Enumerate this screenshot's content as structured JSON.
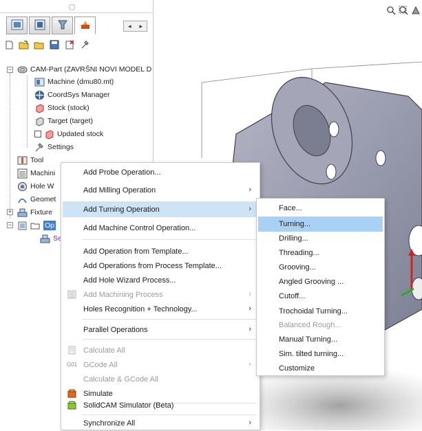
{
  "colors": {
    "menu_highlight": "#cde3f6",
    "submenu_highlight": "#a9d1f5",
    "disabled_text": "#9b9b9b",
    "part_color": "#9ea0b2"
  },
  "icons": {
    "viewport_tools": [
      "zoom-icon",
      "zoom-fit-icon",
      "pan-icon"
    ]
  },
  "panel": {
    "tabs": [
      "solidworks-feature-tab",
      "property-manager-tab",
      "configuration-tab",
      "solidcam-tab"
    ],
    "tab_nav": {
      "left": "◂",
      "right": "▸"
    },
    "toolbar": [
      "new-icon",
      "open-icon",
      "open-folder-icon",
      "save-icon",
      "delete-icon",
      "settings-icon"
    ],
    "tree": {
      "part": "CAM-Part (ZAVRŠNI NOVI MODEL D",
      "machine": "Machine (dmu80.mt)",
      "coordsys": "CoordSys Manager",
      "stock": "Stock (stock)",
      "target": "Target (target)",
      "updated_stock": "Updated stock",
      "settings": "Settings",
      "tool": "Tool",
      "machining": "Machini",
      "hole": "Hole W",
      "geometries": "Geomet",
      "fixtures": "Fixture",
      "operations": "Op",
      "setup": "Se"
    }
  },
  "context_menu": {
    "add_probe": "Add Probe Operation...",
    "add_milling": "Add Milling Operation",
    "add_turning": "Add Turning Operation",
    "add_machine_control": "Add Machine Control Operation...",
    "add_from_template": "Add Operation from Template...",
    "add_from_process_template": "Add Operations from Process Template...",
    "add_hole_wizard": "Add Hole Wizard Process...",
    "add_machining_process": "Add Machining Process",
    "holes_recognition": "Holes Recognition + Technology...",
    "parallel_operations": "Parallel Operations",
    "calculate_all": "Calculate All",
    "gcode_all": "GCode All",
    "calculate_gcode_all": "Calculate & GCode All",
    "simulate": "Simulate",
    "simulator_beta": "SolidCAM Simulator (Beta)",
    "synchronize_all": "Synchronize All",
    "gcode_icon_text": "G01",
    "submenu_arrow": "›"
  },
  "turning_submenu": {
    "face": "Face...",
    "turning": "Turning...",
    "drilling": "Drilling...",
    "threading": "Threading...",
    "grooving": "Grooving...",
    "angled_grooving": "Angled Grooving ...",
    "cutoff": "Cutoff...",
    "trochoidal": "Trochoidal Turning...",
    "balanced_rough": "Balanced Rough...",
    "manual_turning": "Manual Turning...",
    "sim_tilted": "Sim. tilted turning...",
    "customize": "Customize"
  }
}
